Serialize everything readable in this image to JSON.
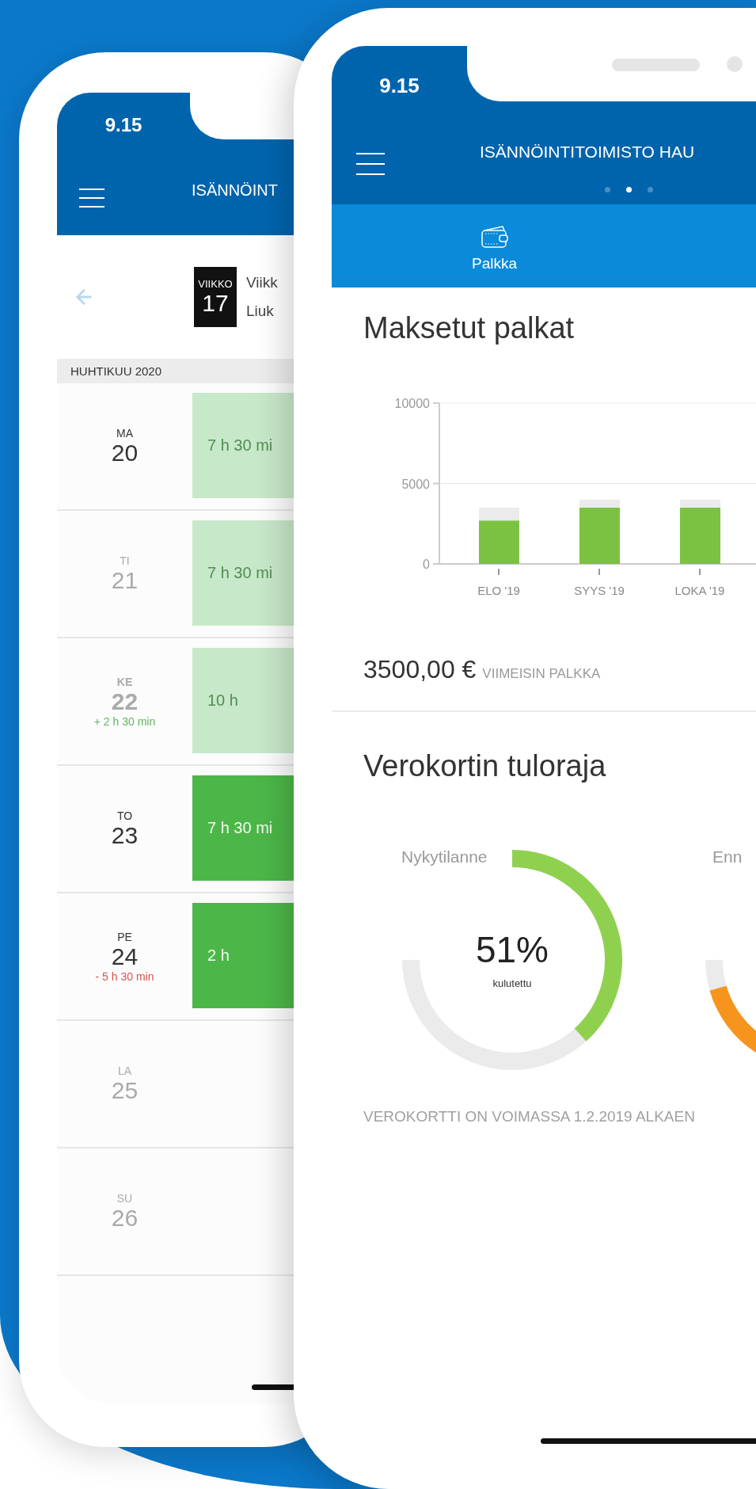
{
  "background_phone": {
    "status_time": "9.15",
    "header_title": "ISÄNNÖINT",
    "week_badge": {
      "label": "VIIKKO",
      "number": "17"
    },
    "week_title": "Viikk",
    "week_subtitle": "Liuk",
    "month_header": "HUHTIKUU 2020",
    "days": [
      {
        "weekday": "MA",
        "date": "20",
        "muted": false,
        "bold": false,
        "entry": {
          "hours": "7 h 30 mi",
          "confirmed": false
        }
      },
      {
        "weekday": "TI",
        "date": "21",
        "muted": true,
        "bold": false,
        "entry": {
          "hours": "7 h 30 mi",
          "confirmed": false
        }
      },
      {
        "weekday": "KE",
        "date": "22",
        "muted": true,
        "bold": true,
        "delta": {
          "text": "+ 2 h 30 min",
          "kind": "over"
        },
        "entry": {
          "hours": "10 h",
          "confirmed": false
        }
      },
      {
        "weekday": "TO",
        "date": "23",
        "muted": false,
        "bold": false,
        "entry": {
          "hours": "7 h 30 mi",
          "confirmed": true
        }
      },
      {
        "weekday": "PE",
        "date": "24",
        "muted": false,
        "bold": false,
        "delta": {
          "text": "- 5 h 30 min",
          "kind": "under"
        },
        "entry": {
          "hours": "2 h",
          "confirmed": true
        }
      },
      {
        "weekday": "LA",
        "date": "25",
        "muted": true,
        "bold": false
      },
      {
        "weekday": "SU",
        "date": "26",
        "muted": true,
        "bold": false
      }
    ]
  },
  "front_phone": {
    "status_time": "9.15",
    "header_title": "ISÄNNÖINTITOIMISTO HAU",
    "pager": [
      {
        "selected": false
      },
      {
        "selected": true
      },
      {
        "selected": false
      }
    ],
    "tabs": [
      {
        "label": "Palkka"
      }
    ],
    "salary_section": {
      "title": "Maksetut palkat",
      "chart_data": {
        "type": "bar",
        "stacked": true,
        "categories": [
          "ELO '19",
          "SYYS '19",
          "LOKA '19"
        ],
        "series": [
          {
            "color": "#7cc242",
            "values": [
              2700,
              3500,
              3500
            ]
          },
          {
            "color": "#ebebeb",
            "values": [
              800,
              500,
              500
            ]
          }
        ],
        "ylim": [
          0,
          10000
        ],
        "yticks": [
          0,
          5000,
          10000
        ]
      },
      "latest_amount": "3500,00 €",
      "latest_label": "VIIMEISIN PALKKA"
    },
    "tax_section": {
      "title": "Verokortin tuloraja",
      "gauges": [
        {
          "label": "Nykytilanne",
          "level": 0.51,
          "value": "51%",
          "caption": "kulutettu",
          "color": "#8fd14f"
        },
        {
          "label": "Enn",
          "level": 0.94,
          "color": "#f7941d"
        }
      ],
      "footer": "VEROKORTTI ON VOIMASSA 1.2.2019 ALKAEN"
    }
  }
}
